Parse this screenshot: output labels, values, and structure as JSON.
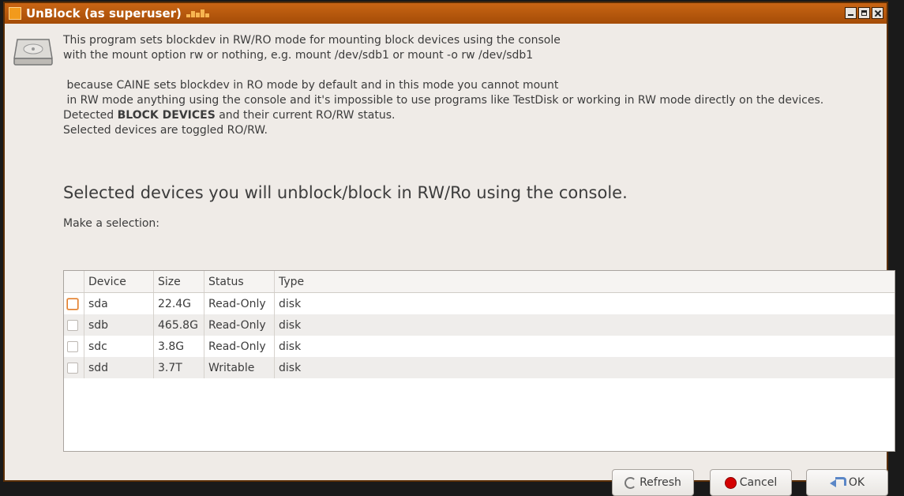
{
  "window": {
    "title": "UnBlock (as superuser)"
  },
  "description": {
    "line1": "This program sets blockdev in RW/RO mode for mounting block devices using the console",
    "line2": "with the mount option rw or nothing, e.g. mount /dev/sdb1 or mount -o rw /dev/sdb1",
    "line3": " because CAINE sets blockdev in RO mode by default and in this mode you cannot mount",
    "line4": " in RW mode anything using the console and it's impossible to use programs like TestDisk or working in RW mode directly on the devices.",
    "line5_prefix": "Detected ",
    "line5_bold": "BLOCK DEVICES",
    "line5_suffix": " and their current RO/RW status.",
    "line6": "Selected devices are toggled RO/RW."
  },
  "headline": "Selected devices you will unblock/block in RW/Ro using the console.",
  "prompt": "Make a selection:",
  "table": {
    "headers": {
      "device": "Device",
      "size": "Size",
      "status": "Status",
      "type": "Type"
    },
    "rows": [
      {
        "device": "sda",
        "size": "22.4G",
        "status": "Read-Only",
        "type": "disk",
        "checked": false
      },
      {
        "device": "sdb",
        "size": "465.8G",
        "status": "Read-Only",
        "type": "disk",
        "checked": false
      },
      {
        "device": "sdc",
        "size": "3.8G",
        "status": "Read-Only",
        "type": "disk",
        "checked": false
      },
      {
        "device": "sdd",
        "size": "3.7T",
        "status": "Writable",
        "type": "disk",
        "checked": false
      }
    ]
  },
  "buttons": {
    "refresh": "Refresh",
    "cancel": "Cancel",
    "ok": "OK"
  },
  "icons": {
    "app": "app-icon",
    "disk": "hard-disk-icon",
    "refresh": "refresh-icon",
    "cancel": "cancel-icon",
    "ok": "ok-arrow-icon"
  },
  "colors": {
    "titlebar": "#b8560c",
    "cancel_icon": "#d40000",
    "focus": "#e07a2a"
  }
}
